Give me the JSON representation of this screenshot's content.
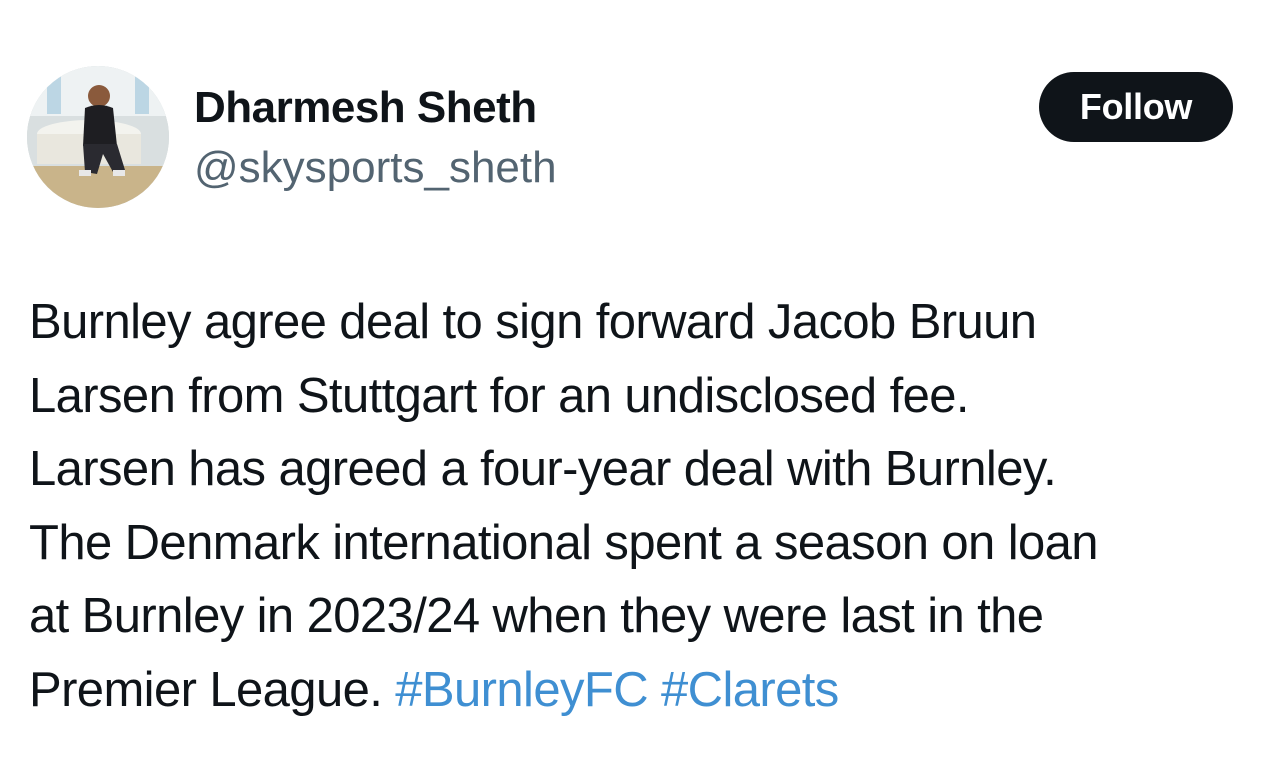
{
  "author": {
    "display_name": "Dharmesh Sheth",
    "handle": "@skysports_sheth"
  },
  "follow_button": {
    "label": "Follow"
  },
  "tweet": {
    "lines": [
      "Burnley agree deal to sign forward Jacob Bruun",
      "Larsen from Stuttgart for an undisclosed fee.",
      "Larsen has agreed a four-year deal with Burnley.",
      "The Denmark international spent a season on loan",
      "at Burnley in 2023/24 when they were last in the"
    ],
    "last_line_text": "Premier League.",
    "hashtags": [
      "#BurnleyFC",
      "#Clarets"
    ]
  },
  "colors": {
    "text": "#0f1419",
    "secondary_text": "#536471",
    "hashtag": "#3f8fd2",
    "button_bg": "#0f1419",
    "button_text": "#ffffff",
    "background": "#ffffff"
  }
}
